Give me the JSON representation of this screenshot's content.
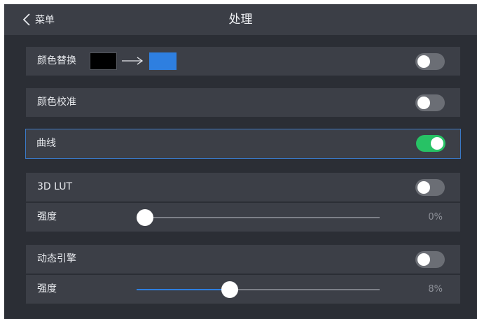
{
  "header": {
    "back_label": "菜单",
    "title": "处理"
  },
  "rows": {
    "color_replace": {
      "label": "颜色替换",
      "enabled": false,
      "source_color": "#000000",
      "target_color": "#2e7fe0"
    },
    "color_calibration": {
      "label": "颜色校准",
      "enabled": false
    },
    "curve": {
      "label": "曲线",
      "enabled": true
    },
    "lut3d": {
      "label": "3D LUT",
      "enabled": false,
      "strength_label": "强度",
      "strength_value": 0,
      "strength_text": "0%"
    },
    "dynamic_engine": {
      "label": "动态引擎",
      "enabled": false,
      "strength_label": "强度",
      "strength_value": 8,
      "strength_text": "8%"
    }
  },
  "colors": {
    "background": "#2b2e35",
    "panel": "#3c3f47",
    "header": "#3b3e46",
    "toggle_on": "#27c265",
    "toggle_off": "#6b6e75",
    "accent": "#2e7fe0",
    "selection_border": "#3a78c6"
  },
  "icons": {
    "back": "chevron-left-icon",
    "arrow": "arrow-right-icon"
  }
}
